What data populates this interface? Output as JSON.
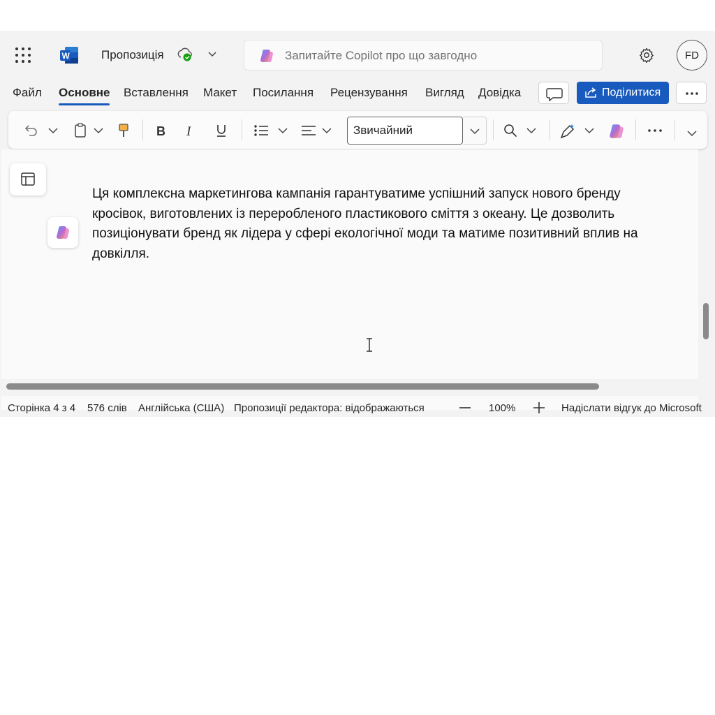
{
  "titlebar": {
    "app_icon": "word-icon",
    "document_title": "Пропозиція",
    "copilot_placeholder": "Запитайте Copilot про що завгодно",
    "avatar_initials": "FD"
  },
  "menu": {
    "tabs": [
      {
        "label": "Файл"
      },
      {
        "label": "Основне"
      },
      {
        "label": "Вставлення"
      },
      {
        "label": "Макет"
      },
      {
        "label": "Посилання"
      },
      {
        "label": "Рецензування"
      },
      {
        "label": "Вигляд"
      },
      {
        "label": "Довідка"
      }
    ],
    "active_tab": "Основне",
    "share_label": "Поділитися"
  },
  "ribbon": {
    "style_value": "Звичайний"
  },
  "document": {
    "paragraph": "Ця комплексна маркетингова кампанія гарантуватиме успішний запуск нового бренду кросівок, виготовлених із переробленого пластикового сміття з океану. Це дозволить позиціонувати бренд як лідера у сфері екологічної моди та матиме позитивний вплив на довкілля."
  },
  "statusbar": {
    "page": "Сторінка 4 з 4",
    "words": "576 слів",
    "language": "Англійська (США)",
    "editor": "Пропозиції редактора: відображаються",
    "zoom": "100%",
    "feedback": "Надіслати відгук до Microsoft"
  },
  "colors": {
    "accent": "#185abd",
    "background": "#f3f3f3"
  }
}
